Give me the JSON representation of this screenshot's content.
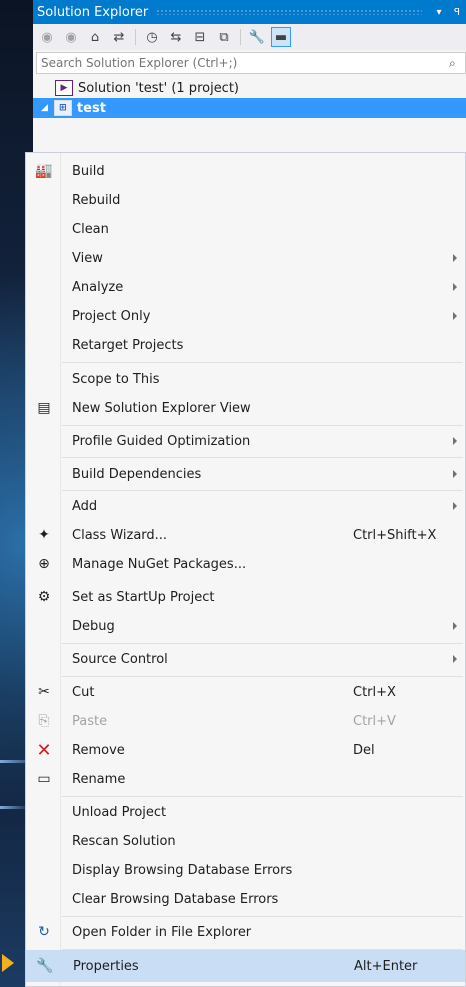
{
  "panel": {
    "title": "Solution Explorer",
    "pin_glyph": "▾",
    "close_glyph": "ꟼ"
  },
  "toolbar": {
    "icons": [
      "back-icon",
      "forward-icon",
      "home-icon",
      "sync-icon",
      "history-icon",
      "pending-changes-icon",
      "collapse-icon",
      "show-all-files-icon",
      "properties-icon",
      "preview-icon"
    ]
  },
  "search": {
    "placeholder": "Search Solution Explorer (Ctrl+;)"
  },
  "tree": {
    "solution_label": "Solution 'test' (1 project)",
    "project_label": "test"
  },
  "menu": {
    "items": [
      {
        "label": "Build",
        "shortcut": "",
        "icon": "build-icon"
      },
      {
        "label": "Rebuild",
        "shortcut": ""
      },
      {
        "label": "Clean",
        "shortcut": ""
      },
      {
        "label": "View",
        "shortcut": "",
        "submenu": true
      },
      {
        "label": "Analyze",
        "shortcut": "",
        "submenu": true
      },
      {
        "label": "Project Only",
        "shortcut": "",
        "submenu": true
      },
      {
        "label": "Retarget Projects",
        "shortcut": ""
      },
      {
        "label": "Scope to This",
        "shortcut": ""
      },
      {
        "label": "New Solution Explorer View",
        "shortcut": "",
        "icon": "new-view-icon"
      },
      {
        "label": "Profile Guided Optimization",
        "shortcut": "",
        "submenu": true
      },
      {
        "label": "Build Dependencies",
        "shortcut": "",
        "submenu": true
      },
      {
        "label": "Add",
        "shortcut": "",
        "submenu": true
      },
      {
        "label": "Class Wizard...",
        "shortcut": "Ctrl+Shift+X",
        "icon": "class-wizard-icon"
      },
      {
        "label": "Manage NuGet Packages...",
        "shortcut": "",
        "icon": "nuget-icon"
      },
      {
        "label": "Set as StartUp Project",
        "shortcut": "",
        "icon": "gear-icon"
      },
      {
        "label": "Debug",
        "shortcut": "",
        "submenu": true
      },
      {
        "label": "Source Control",
        "shortcut": "",
        "submenu": true
      },
      {
        "label": "Cut",
        "shortcut": "Ctrl+X",
        "icon": "scissors-icon"
      },
      {
        "label": "Paste",
        "shortcut": "Ctrl+V",
        "icon": "paste-icon",
        "disabled": true
      },
      {
        "label": "Remove",
        "shortcut": "Del",
        "icon": "remove-icon"
      },
      {
        "label": "Rename",
        "shortcut": "",
        "icon": "rename-icon"
      },
      {
        "label": "Unload Project",
        "shortcut": ""
      },
      {
        "label": "Rescan Solution",
        "shortcut": ""
      },
      {
        "label": "Display Browsing Database Errors",
        "shortcut": ""
      },
      {
        "label": "Clear Browsing Database Errors",
        "shortcut": ""
      },
      {
        "label": "Open Folder in File Explorer",
        "shortcut": "",
        "icon": "open-folder-icon"
      },
      {
        "label": "Properties",
        "shortcut": "Alt+Enter",
        "icon": "wrench-icon",
        "highlighted": true
      }
    ]
  }
}
